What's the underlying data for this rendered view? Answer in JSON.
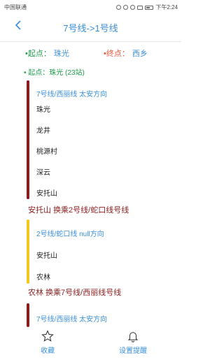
{
  "status_bar": {
    "carrier": "中国联通",
    "time": "下午2:24"
  },
  "header": {
    "title": "7号线->1号线"
  },
  "summary": {
    "start_label": "起点：",
    "start_value": "珠光",
    "end_label": "终点：",
    "end_value": "西乡"
  },
  "start_line": "起点：珠光 (23站)",
  "segments": [
    {
      "label": "7号线/西丽线 太安方向",
      "color": "#8b1c1c",
      "stops": [
        "珠光",
        "龙井",
        "桃源村",
        "深云",
        "安托山"
      ],
      "transfer": "安托山 换乘2号线/蛇口线号线"
    },
    {
      "label": "2号线/蛇口线 null方向",
      "color": "#f2c81e",
      "stops": [
        "安托山",
        "农林"
      ],
      "transfer": "农林 换乘7号线/西丽线号线"
    },
    {
      "label": "7号线/西丽线 太安方向",
      "color": "#8b1c1c",
      "stops": [],
      "transfer": ""
    }
  ],
  "bottom_nav": {
    "favorite_label": "收藏",
    "reminder_label": "设置提醒"
  },
  "colors": {
    "accent": "#3a8fd9",
    "start_green": "#1e9b4a",
    "end_red": "#e7583b",
    "transfer_text": "#8b1c1c"
  },
  "icons": [
    "back-arrow-icon",
    "star-icon",
    "bell-icon"
  ]
}
